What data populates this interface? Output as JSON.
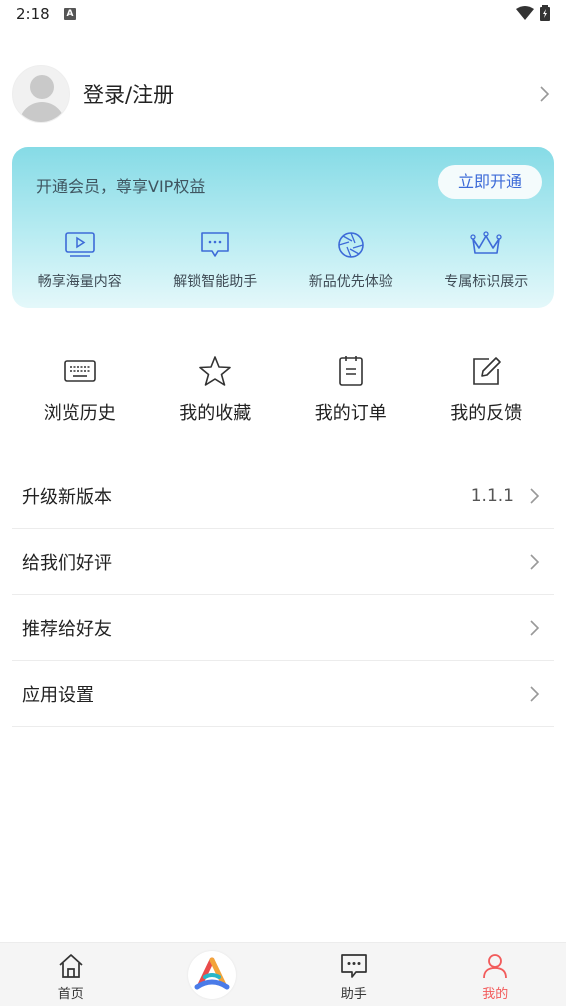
{
  "status_bar": {
    "time": "2:18",
    "notification_badge": "A"
  },
  "profile": {
    "label": "登录/注册"
  },
  "vip": {
    "promo_text": "开通会员，尊享VIP权益",
    "button_label": "立即开通",
    "features": [
      {
        "label": "畅享海量内容",
        "icon": "play-screen-icon"
      },
      {
        "label": "解锁智能助手",
        "icon": "chat-bubble-icon"
      },
      {
        "label": "新品优先体验",
        "icon": "aperture-icon"
      },
      {
        "label": "专属标识展示",
        "icon": "crown-icon"
      }
    ],
    "accent_color": "#3d6bd8"
  },
  "quick": [
    {
      "label": "浏览历史",
      "icon": "keyboard-history-icon"
    },
    {
      "label": "我的收藏",
      "icon": "star-icon"
    },
    {
      "label": "我的订单",
      "icon": "notepad-icon"
    },
    {
      "label": "我的反馈",
      "icon": "edit-icon"
    }
  ],
  "menu": [
    {
      "label": "升级新版本",
      "value": "1.1.1"
    },
    {
      "label": "给我们好评",
      "value": ""
    },
    {
      "label": "推荐给好友",
      "value": ""
    },
    {
      "label": "应用设置",
      "value": ""
    }
  ],
  "tabs": [
    {
      "label": "首页",
      "icon": "home-icon",
      "active": false
    },
    {
      "label": "",
      "icon": "app-logo-icon",
      "active": false
    },
    {
      "label": "助手",
      "icon": "chat-icon",
      "active": false
    },
    {
      "label": "我的",
      "icon": "person-icon",
      "active": true
    }
  ],
  "colors": {
    "active_tab": "#f25b5b"
  }
}
